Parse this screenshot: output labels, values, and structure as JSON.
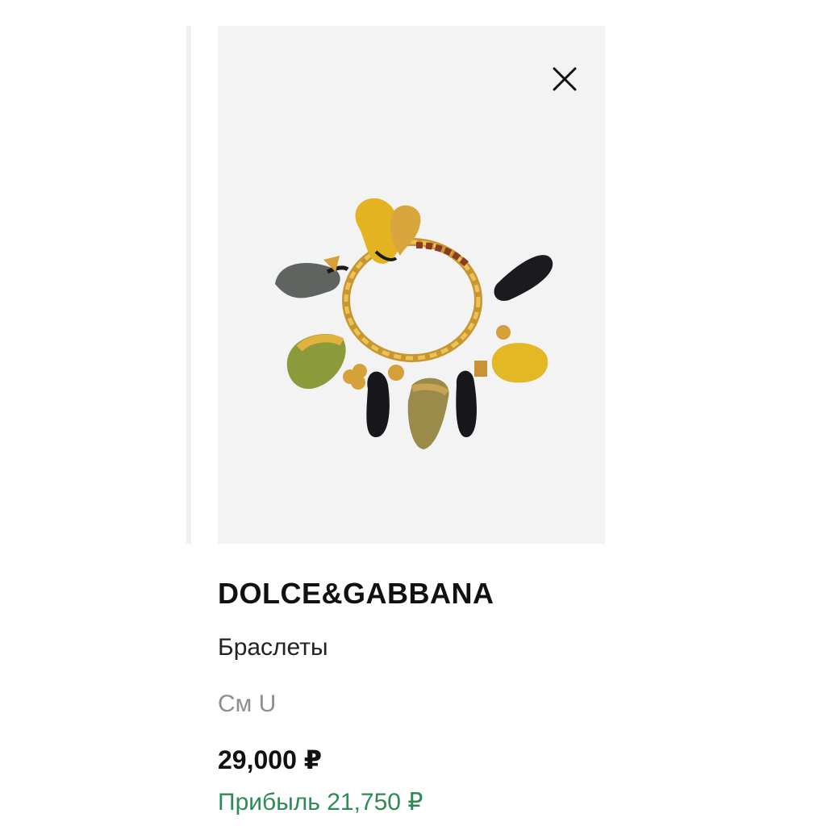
{
  "product": {
    "brand": "DOLCE&GABBANA",
    "category": "Браслеты",
    "size": "См U",
    "price": "29,000 ₽",
    "profit": "Прибыль 21,750 ₽"
  },
  "icons": {
    "close": "close-icon",
    "image": "charm-bracelet-photo"
  },
  "colors": {
    "profit_green": "#2e8b57",
    "image_background": "#f3f3f3"
  }
}
